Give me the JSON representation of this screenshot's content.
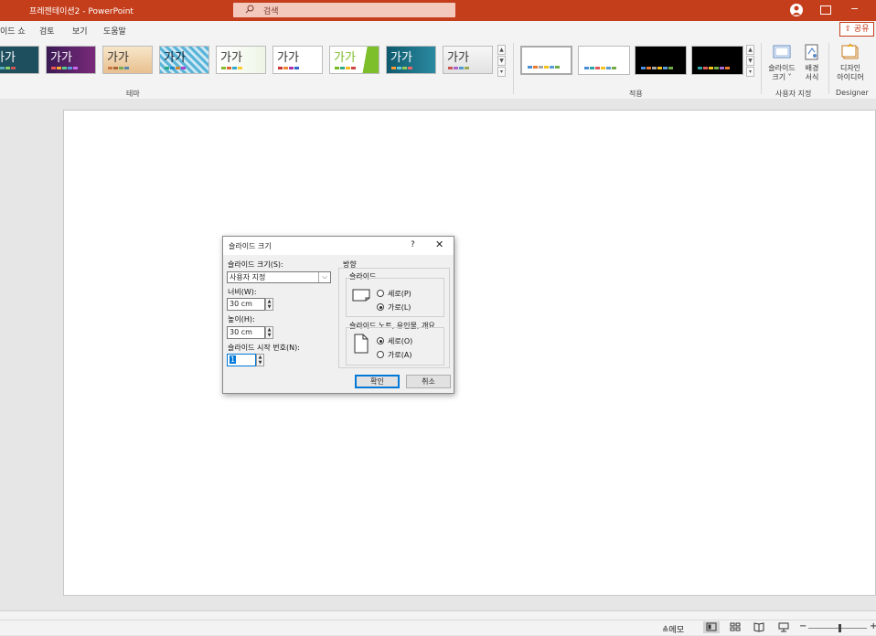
{
  "titlebar": {
    "doc_title": "프레젠테이션2  -  PowerPoint",
    "search_placeholder": "검색",
    "minimize_glyph": "−"
  },
  "tabs": [
    {
      "label": "이드 쇼"
    },
    {
      "label": "검토"
    },
    {
      "label": "보기"
    },
    {
      "label": "도움말"
    }
  ],
  "share_label": "공유",
  "themes": {
    "sample_text": "가가",
    "group_label": "테마"
  },
  "variants": {
    "group_label": "적용"
  },
  "customize": {
    "slide_size_label_1": "슬라이드",
    "slide_size_label_2": "크기 ˅",
    "background_label_1": "배경",
    "background_label_2": "서식",
    "group_label": "사용자 지정"
  },
  "designer": {
    "label_1": "디자인",
    "label_2": "아이디어",
    "group_label": "Designer"
  },
  "dialog": {
    "title": "슬라이드 크기",
    "help_glyph": "?",
    "close_glyph": "✕",
    "slide_size_label": "슬라이드 크기(S):",
    "slide_size_value": "사용자 지정",
    "width_label": "너비(W):",
    "width_value": "30 cm",
    "height_label": "높이(H):",
    "height_value": "30 cm",
    "start_number_label": "슬라이드 시작 번호(N):",
    "start_number_value": "1",
    "orientation_label": "방향",
    "slides_group_label": "슬라이드",
    "slides_portrait": "세로(P)",
    "slides_landscape": "가로(L)",
    "slides_selected": "landscape",
    "notes_group_label": "슬라이드 노트, 유인물, 개요",
    "notes_portrait": "세로(O)",
    "notes_landscape": "가로(A)",
    "notes_selected": "portrait",
    "ok_label": "확인",
    "cancel_label": "취소"
  },
  "statusbar": {
    "notes_label": "메모",
    "zoom_minus": "−",
    "zoom_plus": "+"
  },
  "colors": {
    "accent": "#c43e1c",
    "dialog_default_border": "#0078d7"
  }
}
